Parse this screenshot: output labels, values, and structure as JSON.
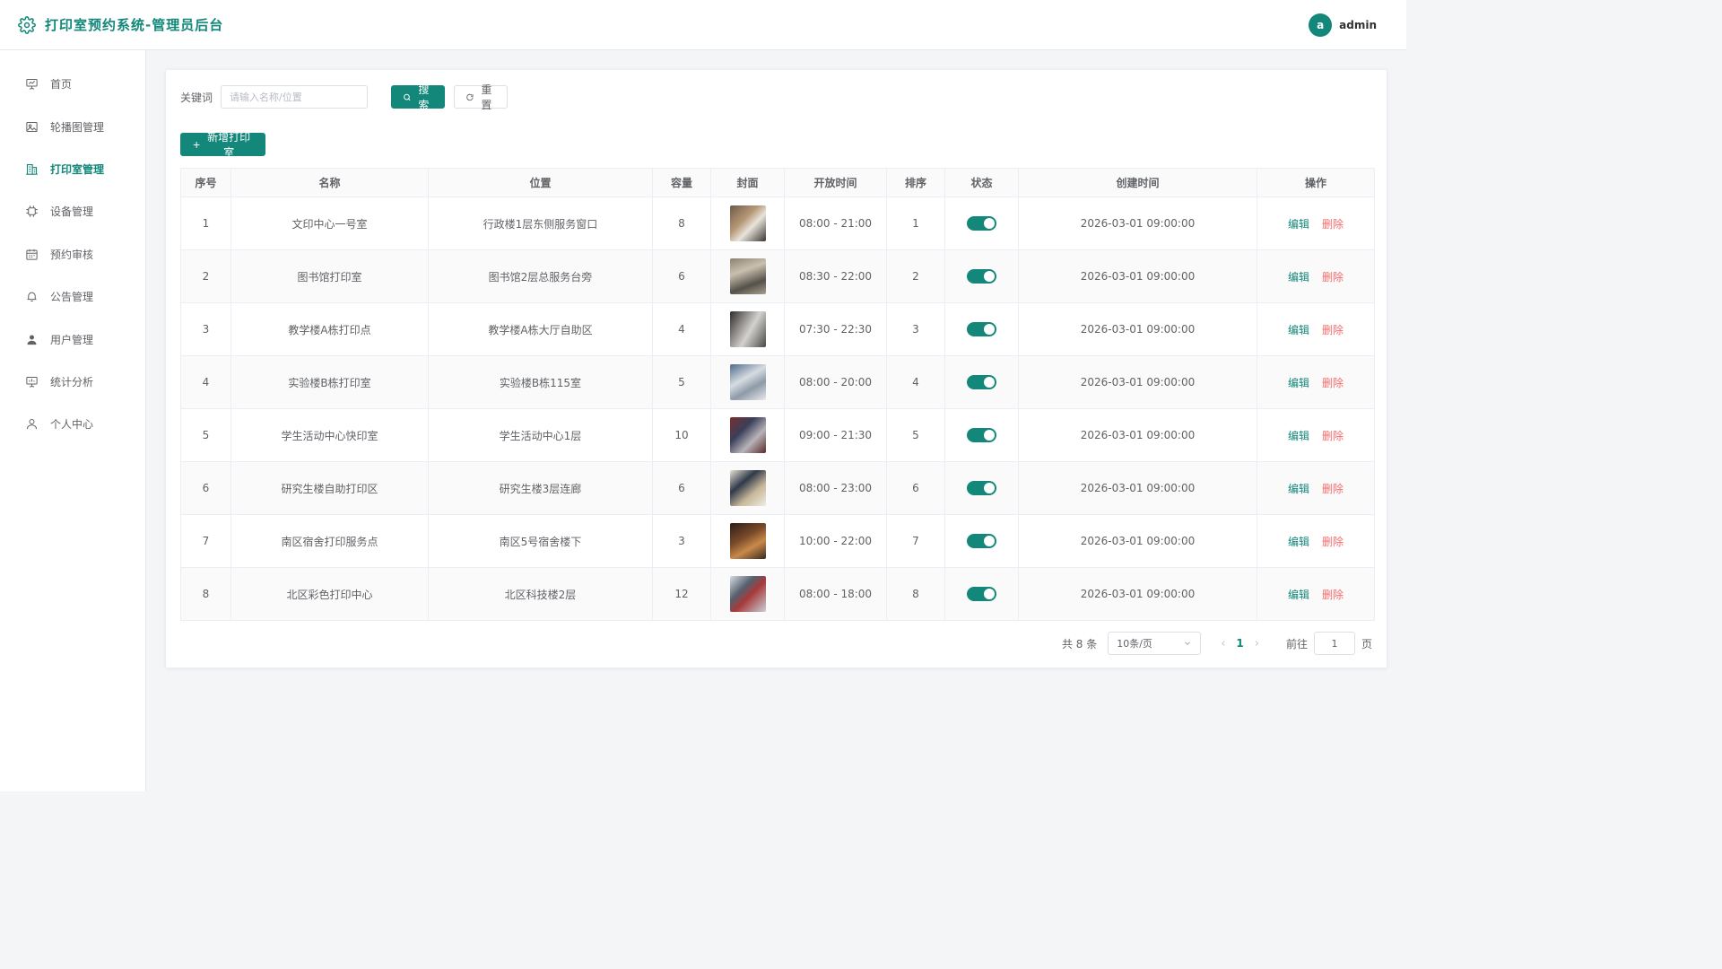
{
  "header": {
    "title": "打印室预约系统-管理员后台",
    "avatar_letter": "a",
    "username": "admin",
    "accent_color": "#12877a"
  },
  "sidebar": {
    "items": [
      {
        "label": "首页",
        "icon": "presentation-icon",
        "active": false
      },
      {
        "label": "轮播图管理",
        "icon": "image-icon",
        "active": false
      },
      {
        "label": "打印室管理",
        "icon": "building-icon",
        "active": true
      },
      {
        "label": "设备管理",
        "icon": "chip-icon",
        "active": false
      },
      {
        "label": "预约审核",
        "icon": "calendar-icon",
        "active": false
      },
      {
        "label": "公告管理",
        "icon": "bell-icon",
        "active": false
      },
      {
        "label": "用户管理",
        "icon": "user-filled-icon",
        "active": false
      },
      {
        "label": "统计分析",
        "icon": "chart-board-icon",
        "active": false
      },
      {
        "label": "个人中心",
        "icon": "user-icon",
        "active": false
      }
    ]
  },
  "filter": {
    "keyword_label": "关键词",
    "keyword_placeholder": "请输入名称/位置",
    "keyword_value": "",
    "search_label": "搜索",
    "reset_label": "重置"
  },
  "toolbar": {
    "add_label": "新增打印室"
  },
  "table": {
    "columns": [
      "序号",
      "名称",
      "位置",
      "容量",
      "封面",
      "开放时间",
      "排序",
      "状态",
      "创建时间",
      "操作"
    ],
    "edit_label": "编辑",
    "delete_label": "删除",
    "rows": [
      {
        "index": "1",
        "name": "文印中心一号室",
        "location": "行政楼1层东侧服务窗口",
        "capacity": "8",
        "hours": "08:00 - 21:00",
        "sort": "1",
        "enabled": true,
        "created": "2026-03-01 09:00:00"
      },
      {
        "index": "2",
        "name": "图书馆打印室",
        "location": "图书馆2层总服务台旁",
        "capacity": "6",
        "hours": "08:30 - 22:00",
        "sort": "2",
        "enabled": true,
        "created": "2026-03-01 09:00:00"
      },
      {
        "index": "3",
        "name": "教学楼A栋打印点",
        "location": "教学楼A栋大厅自助区",
        "capacity": "4",
        "hours": "07:30 - 22:30",
        "sort": "3",
        "enabled": true,
        "created": "2026-03-01 09:00:00"
      },
      {
        "index": "4",
        "name": "实验楼B栋打印室",
        "location": "实验楼B栋115室",
        "capacity": "5",
        "hours": "08:00 - 20:00",
        "sort": "4",
        "enabled": true,
        "created": "2026-03-01 09:00:00"
      },
      {
        "index": "5",
        "name": "学生活动中心快印室",
        "location": "学生活动中心1层",
        "capacity": "10",
        "hours": "09:00 - 21:30",
        "sort": "5",
        "enabled": true,
        "created": "2026-03-01 09:00:00"
      },
      {
        "index": "6",
        "name": "研究生楼自助打印区",
        "location": "研究生楼3层连廊",
        "capacity": "6",
        "hours": "08:00 - 23:00",
        "sort": "6",
        "enabled": true,
        "created": "2026-03-01 09:00:00"
      },
      {
        "index": "7",
        "name": "南区宿舍打印服务点",
        "location": "南区5号宿舍楼下",
        "capacity": "3",
        "hours": "10:00 - 22:00",
        "sort": "7",
        "enabled": true,
        "created": "2026-03-01 09:00:00"
      },
      {
        "index": "8",
        "name": "北区彩色打印中心",
        "location": "北区科技楼2层",
        "capacity": "12",
        "hours": "08:00 - 18:00",
        "sort": "8",
        "enabled": true,
        "created": "2026-03-01 09:00:00"
      }
    ]
  },
  "pagination": {
    "total_text": "共 8 条",
    "page_size": "10条/页",
    "current_page": "1",
    "goto_label": "前往",
    "goto_value": "1",
    "page_unit": "页"
  }
}
